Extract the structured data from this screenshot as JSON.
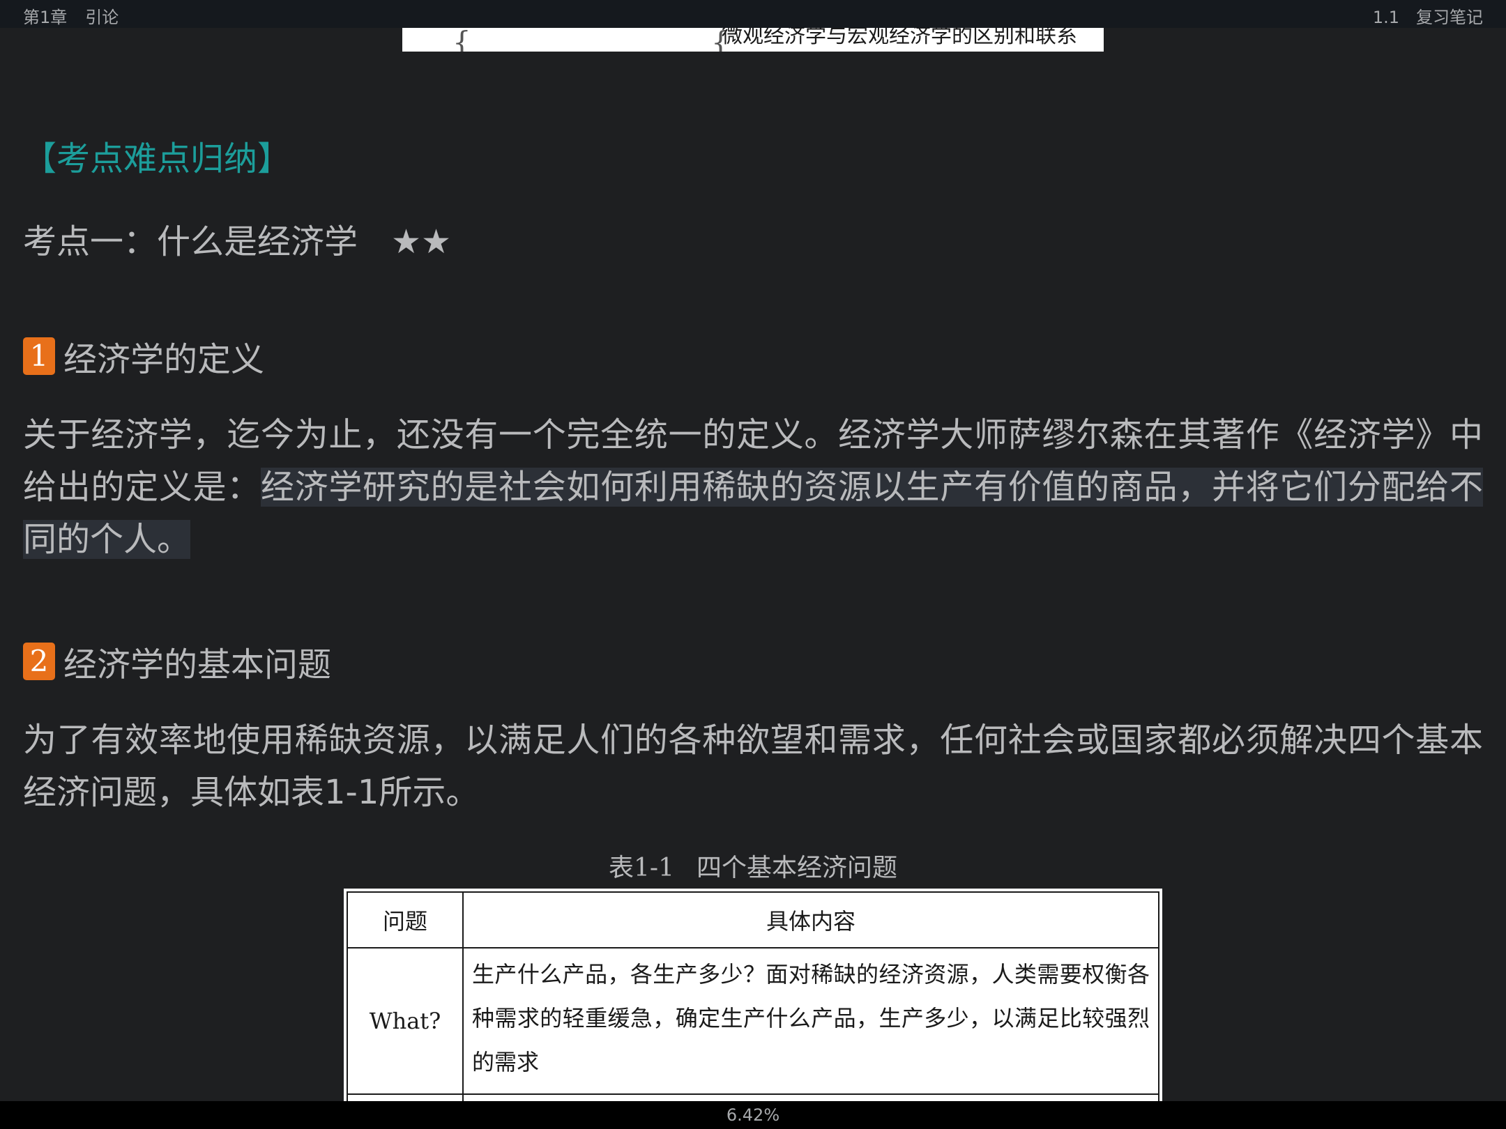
{
  "header": {
    "chapter": "第1章",
    "chapter_title": "引论",
    "section_number": "1.1",
    "section_title": "复习笔记"
  },
  "image_strip": {
    "text": "微观经济学与宏观经济学的区别和联系"
  },
  "content": {
    "section_title": "【考点难点归纳】",
    "kaodian_title": "考点一：什么是经济学",
    "kaodian_stars": "★★",
    "heading1": {
      "number": "1",
      "text": "经济学的定义"
    },
    "para1_plain": "关于经济学，迄今为止，还没有一个完全统一的定义。经济学大师萨缪尔森在其著作《经济学》中给出的定义是：",
    "para1_highlight": "经济学研究的是社会如何利用稀缺的资源以生产有价值的商品，并将它们分配给不同的个人。",
    "heading2": {
      "number": "2",
      "text": "经济学的基本问题"
    },
    "para2": "为了有效率地使用稀缺资源，以满足人们的各种欲望和需求，任何社会或国家都必须解决四个基本经济问题，具体如表1-1所示。"
  },
  "table": {
    "caption_number": "表1-1",
    "caption_title": "四个基本经济问题",
    "headers": [
      "问题",
      "具体内容"
    ],
    "rows": [
      {
        "question": "What?",
        "content": "生产什么产品，各生产多少？面对稀缺的经济资源，人类需要权衡各种需求的轻重缓急，确定生产什么产品，生产多少，以满足比较强烈的需求"
      }
    ]
  },
  "footer": {
    "progress": "6.42%"
  },
  "colors": {
    "background": "#1e1f21",
    "accent_teal": "#1c9e9b",
    "badge_orange": "#e8701a",
    "highlight": "#2c3037"
  }
}
